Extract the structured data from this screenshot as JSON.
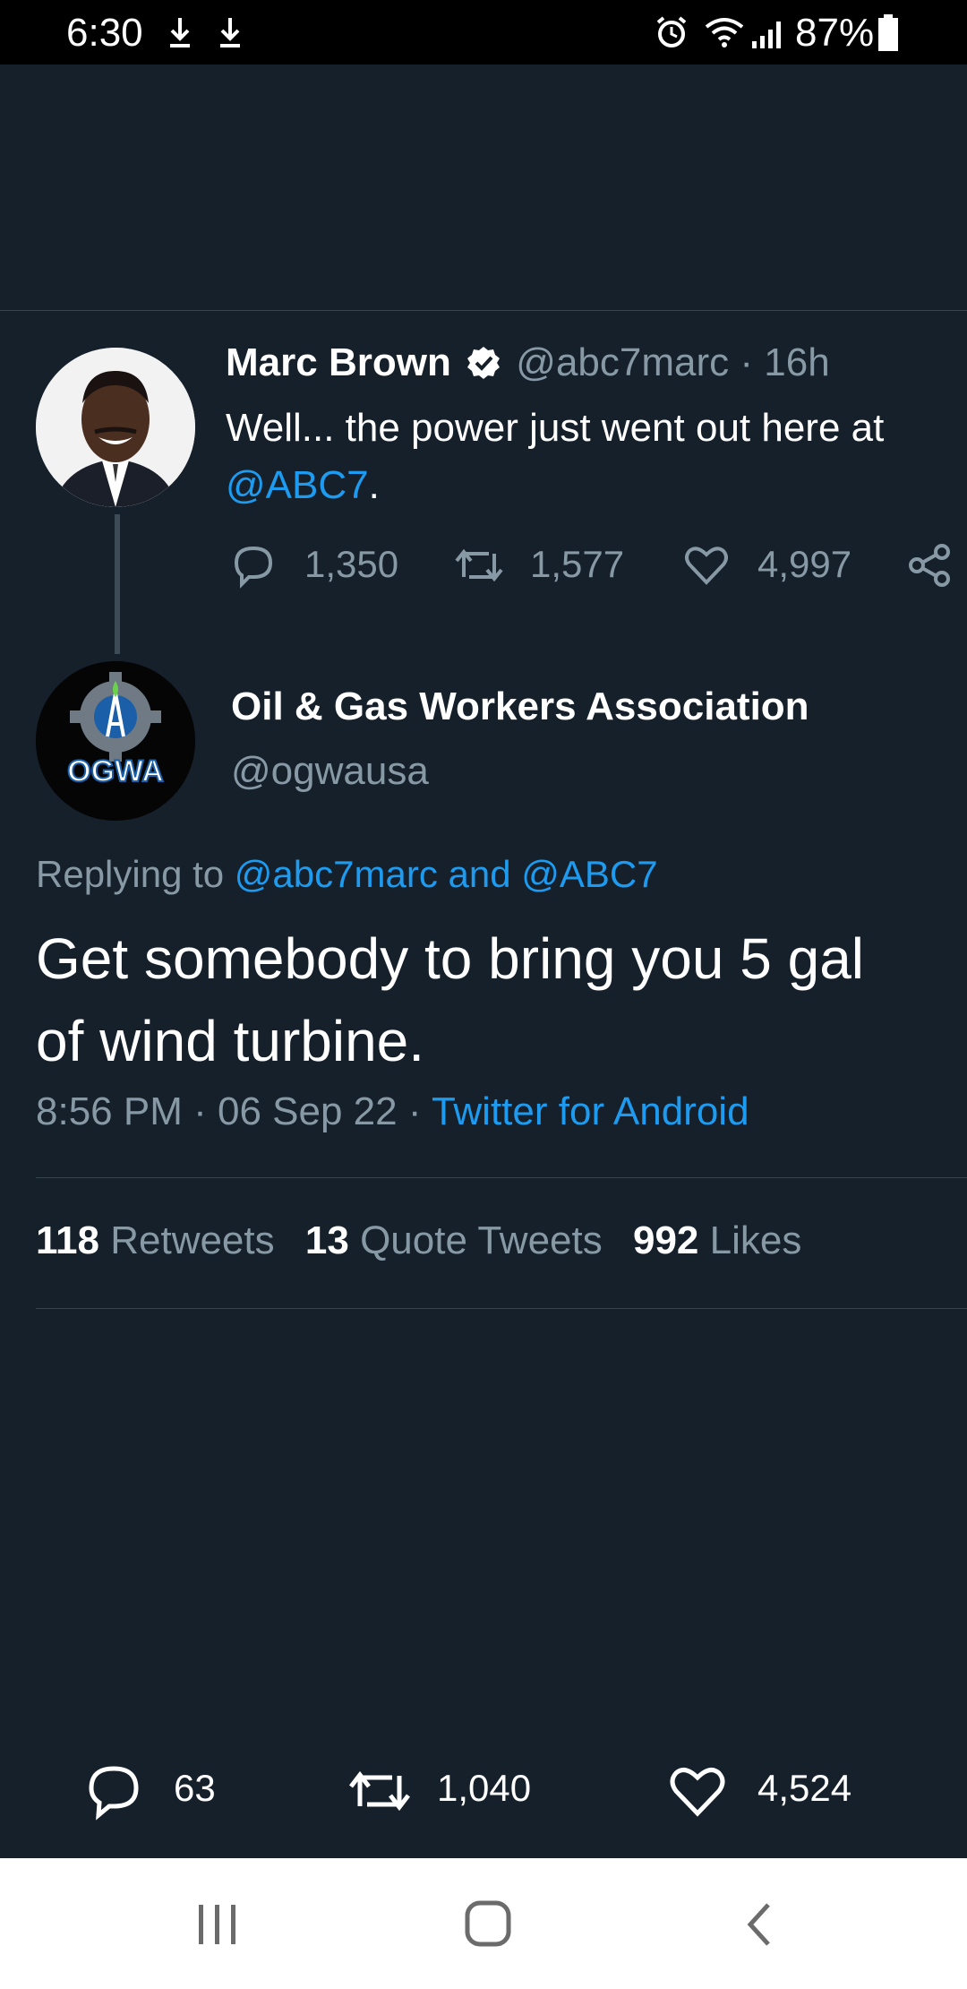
{
  "status_bar": {
    "time": "6:30",
    "battery": "87%",
    "icons": [
      "download-icon",
      "download-icon",
      "alarm-icon",
      "wifi-icon",
      "signal-icon",
      "battery-icon"
    ]
  },
  "parent_tweet": {
    "name": "Marc Brown",
    "handle": "@abc7marc",
    "time": "16h",
    "text": "Well... the power just went out here at",
    "mention": "@ABC7",
    "trailing": ".",
    "replies": "1,350",
    "retweets": "1,577",
    "likes": "4,997"
  },
  "main_tweet": {
    "name": "Oil & Gas Workers Association",
    "handle": "@ogwausa",
    "avatar_logo_text": "OGWA",
    "replying_prefix": "Replying to",
    "replying_users": "@abc7marc and @ABC7",
    "text_line1": "Get somebody to bring you 5 gal",
    "text_line2": "of wind turbine.",
    "time": "8:56 PM",
    "date": "06 Sep 22",
    "source": "Twitter for Android",
    "retweets_count": "118",
    "retweets_label": "Retweets",
    "quotes_count": "13",
    "quotes_label": "Quote Tweets",
    "likes_count": "992",
    "likes_label": "Likes"
  },
  "bottom_actions": {
    "replies": "63",
    "retweets": "1,040",
    "likes": "4,524"
  },
  "colors": {
    "background": "#15202b",
    "accent": "#1d9bf0",
    "muted": "#8899a6",
    "divider": "#38444d"
  }
}
